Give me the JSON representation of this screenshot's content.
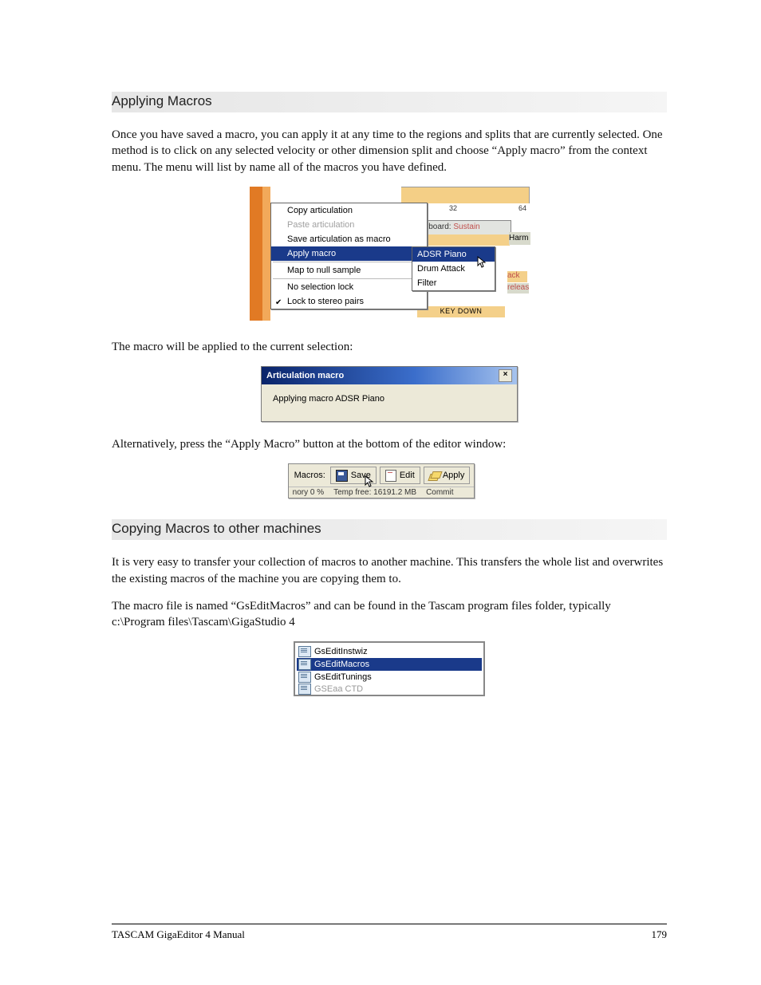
{
  "headings": {
    "applying": "Applying Macros",
    "copying": "Copying Macros to other machines"
  },
  "paras": {
    "p1": "Once you have saved a macro, you can apply it at any time to the regions and splits that are currently selected.  One method is to click on any selected velocity or other dimension split and choose “Apply macro” from the context menu.  The menu will list by name all of the macros you have defined.",
    "p2": "The macro will be applied to the current selection:",
    "p3": "Alternatively, press the “Apply Macro” button at the bottom of the editor window:",
    "p4": "It is very easy to transfer your collection of macros to another machine.  This transfers the whole list and overwrites the existing macros of the machine you are copying them to.",
    "p5": "The macro file is named “GsEditMacros” and can be found in the Tascam program files folder, typically c:\\Program files\\Tascam\\GigaStudio 4"
  },
  "context_menu": {
    "items": {
      "copy": "Copy articulation",
      "paste": "Paste articulation",
      "save_as_macro": "Save articulation as macro",
      "apply_macro": "Apply macro",
      "map_null": "Map to null sample",
      "no_lock": "No selection lock",
      "lock_stereo": "Lock to stereo pairs"
    },
    "submenu": {
      "adsr": "ADSR Piano",
      "drum": "Drum Attack",
      "filter": "Filter"
    },
    "panel": {
      "tick32": "32",
      "tick64": "64",
      "keyboard_label": "Keyboard:",
      "sustain": "Sustain",
      "tain": "tain",
      "harm": "Harm",
      "ack": "ack",
      "releas": "releas",
      "keydown": "KEY DOWN"
    }
  },
  "dialog": {
    "title": "Articulation macro",
    "body": "Applying macro ADSR Piano"
  },
  "toolbar": {
    "label": "Macros:",
    "save": "Save",
    "edit": "Edit",
    "apply": "Apply",
    "status_left": "nory 0 %",
    "status_mid": "Temp free: 16191.2 MB",
    "status_right": "Commit"
  },
  "filelist": {
    "f1": "GsEditInstwiz",
    "f2": "GsEditMacros",
    "f3": "GsEditTunings",
    "f4": "GSEaa CTD"
  },
  "footer": {
    "left": "TASCAM GigaEditor 4 Manual",
    "right": "179"
  }
}
